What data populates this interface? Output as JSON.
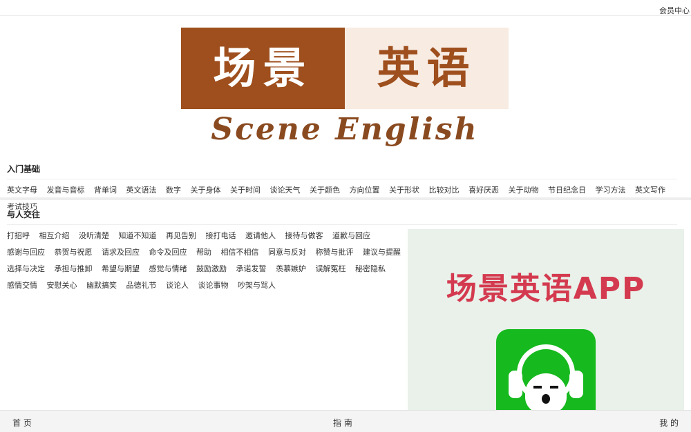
{
  "header": {
    "member_center": "会员中心"
  },
  "logo": {
    "cn_left": "场景",
    "cn_right": "英语",
    "en": "Scene English"
  },
  "sections": {
    "basics": {
      "title": "入门基础",
      "links": [
        "英文字母",
        "发音与音标",
        "背单词",
        "英文语法",
        "数字",
        "关于身体",
        "关于时间",
        "谈论天气",
        "关于颜色",
        "方向位置",
        "关于形状",
        "比较对比",
        "喜好厌恶",
        "关于动物",
        "节日纪念日",
        "学习方法",
        "英文写作",
        "考试技巧"
      ]
    },
    "social": {
      "title": "与人交往",
      "links": [
        "打招呼",
        "相互介绍",
        "没听清楚",
        "知道不知道",
        "再见告别",
        "接打电话",
        "邀请他人",
        "接待与做客",
        "道歉与回应",
        "感谢与回应",
        "恭贺与祝愿",
        "请求及回应",
        "命令及回应",
        "帮助",
        "相信不相信",
        "同意与反对",
        "称赞与批评",
        "建议与提醒",
        "选择与决定",
        "承担与推卸",
        "希望与期望",
        "感觉与情绪",
        "鼓励激励",
        "承诺发誓",
        "羡慕嫉妒",
        "误解冤枉",
        "秘密隐私",
        "感情交情",
        "安慰关心",
        "幽默搞笑",
        "品德礼节",
        "谈论人",
        "谈论事物",
        "吵架与骂人"
      ]
    }
  },
  "app_promo": {
    "title": "场景英语APP",
    "icon": "headphone-mascot-icon"
  },
  "bottom_nav": {
    "home": "首 页",
    "guide": "指 南",
    "mine": "我 的"
  },
  "colors": {
    "brand_brown": "#9e4f1d",
    "app_red": "#d43a4f",
    "app_green": "#16b91e"
  }
}
